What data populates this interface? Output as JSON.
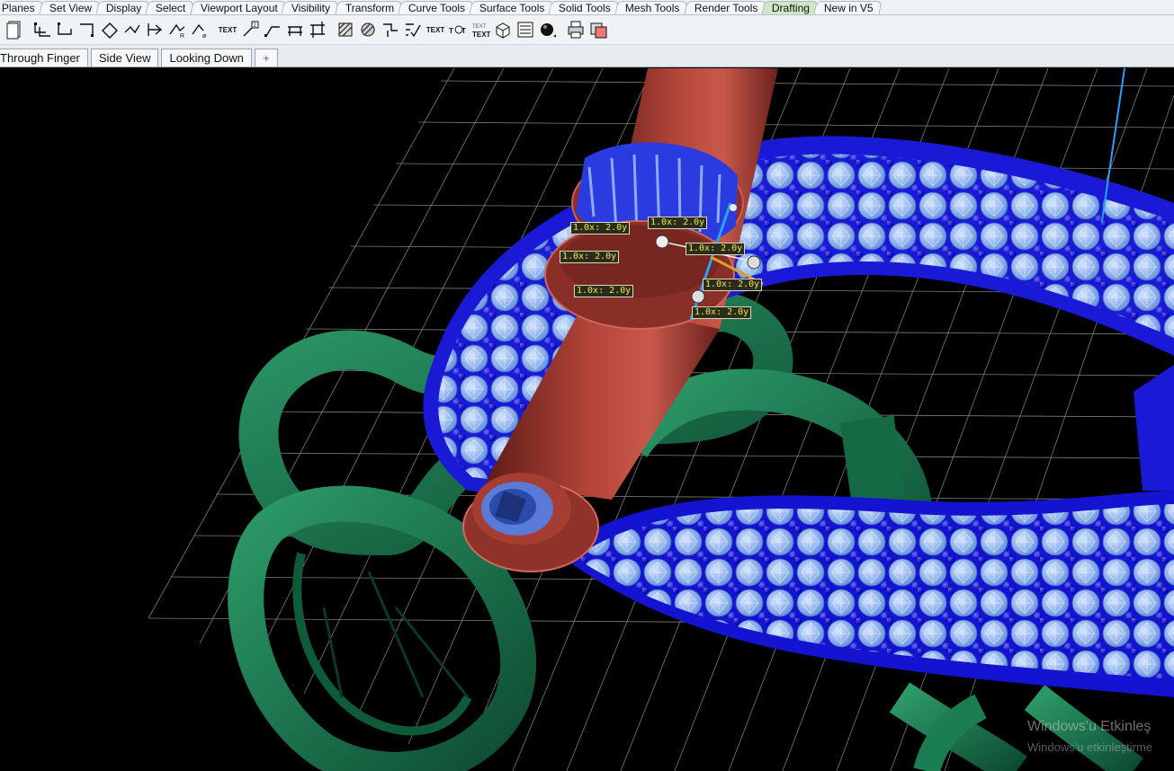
{
  "menu_tabs": [
    {
      "label": "Planes"
    },
    {
      "label": "Set View"
    },
    {
      "label": "Display"
    },
    {
      "label": "Select"
    },
    {
      "label": "Viewport Layout"
    },
    {
      "label": "Visibility"
    },
    {
      "label": "Transform"
    },
    {
      "label": "Curve Tools"
    },
    {
      "label": "Surface Tools"
    },
    {
      "label": "Solid Tools"
    },
    {
      "label": "Mesh Tools"
    },
    {
      "label": "Render Tools"
    },
    {
      "label": "Drafting",
      "active": true
    },
    {
      "label": "New in V5"
    }
  ],
  "toolbar": {
    "text_label": "TEXT",
    "text_label_2": "TEXT",
    "text_stack": "TEXT",
    "dim_2": "2"
  },
  "viewport_tabs": [
    "Through Finger",
    "Side View",
    "Looking Down"
  ],
  "add_tab_symbol": "+",
  "dimension_labels": [
    "1.0x: 2.0y",
    "1.0x: 2.0y",
    "1.0x: 2.0y",
    "1.0x: 2.0y",
    "1.0x: 2.0y",
    "1.0x: 2.0y",
    "1.0x: 2.0y"
  ],
  "watermark": {
    "line1": "Windows'u Etkinleş",
    "line2": "Windows'u etkinleştirme"
  },
  "colors": {
    "tube": "#9b3b32",
    "band": "#1414d0",
    "gem": "#8fb4f0",
    "prong": "#0a0ad8",
    "link": "#17704a",
    "grid": "#8a8a8a",
    "active_tab": "#cfe7c4"
  }
}
